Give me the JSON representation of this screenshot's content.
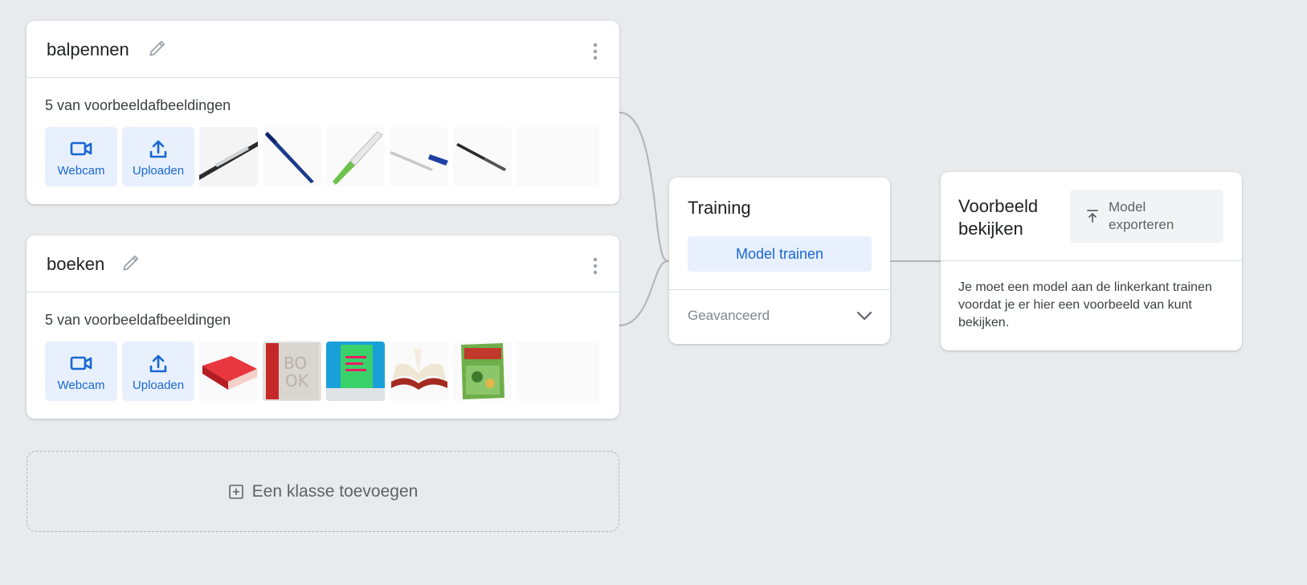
{
  "classes": [
    {
      "name": "balpennen",
      "samples_label": "5 van voorbeeldafbeeldingen",
      "webcam_label": "Webcam",
      "upload_label": "Uploaden",
      "thumbnails": [
        "pen-thumbnail",
        "pen-thumbnail",
        "pen-thumbnail",
        "pen-thumbnail",
        "pen-thumbnail"
      ]
    },
    {
      "name": "boeken",
      "samples_label": "5 van voorbeeldafbeeldingen",
      "webcam_label": "Webcam",
      "upload_label": "Uploaden",
      "thumbnails": [
        "book-thumbnail",
        "book-thumbnail",
        "book-thumbnail",
        "book-thumbnail",
        "book-thumbnail"
      ]
    }
  ],
  "add_class_label": "Een klasse toevoegen",
  "training": {
    "title": "Training",
    "train_button": "Model trainen",
    "advanced_label": "Geavanceerd"
  },
  "preview": {
    "title": "Voorbeeld bekijken",
    "export_button": "Model exporteren",
    "message": "Je moet een model aan de linkerkant trainen voordat je er hier een voorbeeld van kunt bekijken."
  },
  "colors": {
    "background": "#e8eaed",
    "accent": "#1967d2",
    "accent_light": "#e8f0fe"
  }
}
